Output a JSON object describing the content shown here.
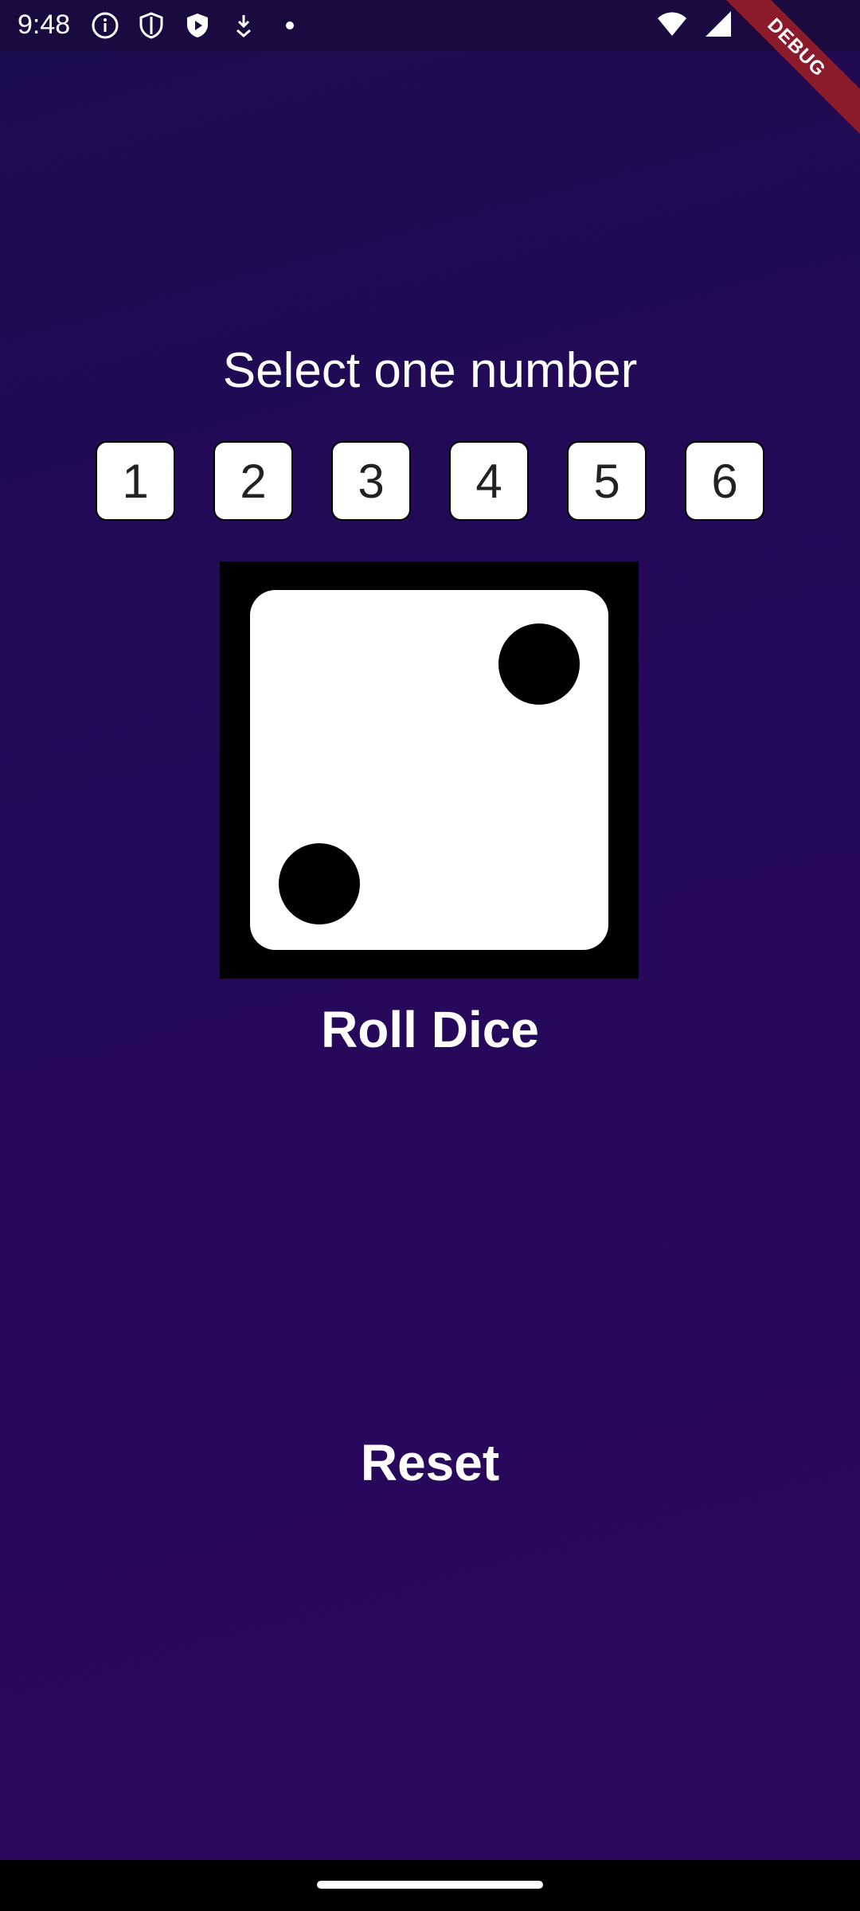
{
  "status_bar": {
    "time": "9:48",
    "icons_left": [
      "info-icon",
      "shield-icon",
      "play-protect-icon",
      "download-icon",
      "dot-icon"
    ],
    "icons_right": [
      "wifi-icon",
      "signal-icon"
    ]
  },
  "debug_banner": "DEBUG",
  "title": "Select one number",
  "numbers": [
    "1",
    "2",
    "3",
    "4",
    "5",
    "6"
  ],
  "dice": {
    "value": 2
  },
  "roll_label": "Roll Dice",
  "reset_label": "Reset",
  "colors": {
    "background": "#24095a",
    "status_bar": "#1a0a40",
    "debug_ribbon": "#8b1a2b"
  }
}
